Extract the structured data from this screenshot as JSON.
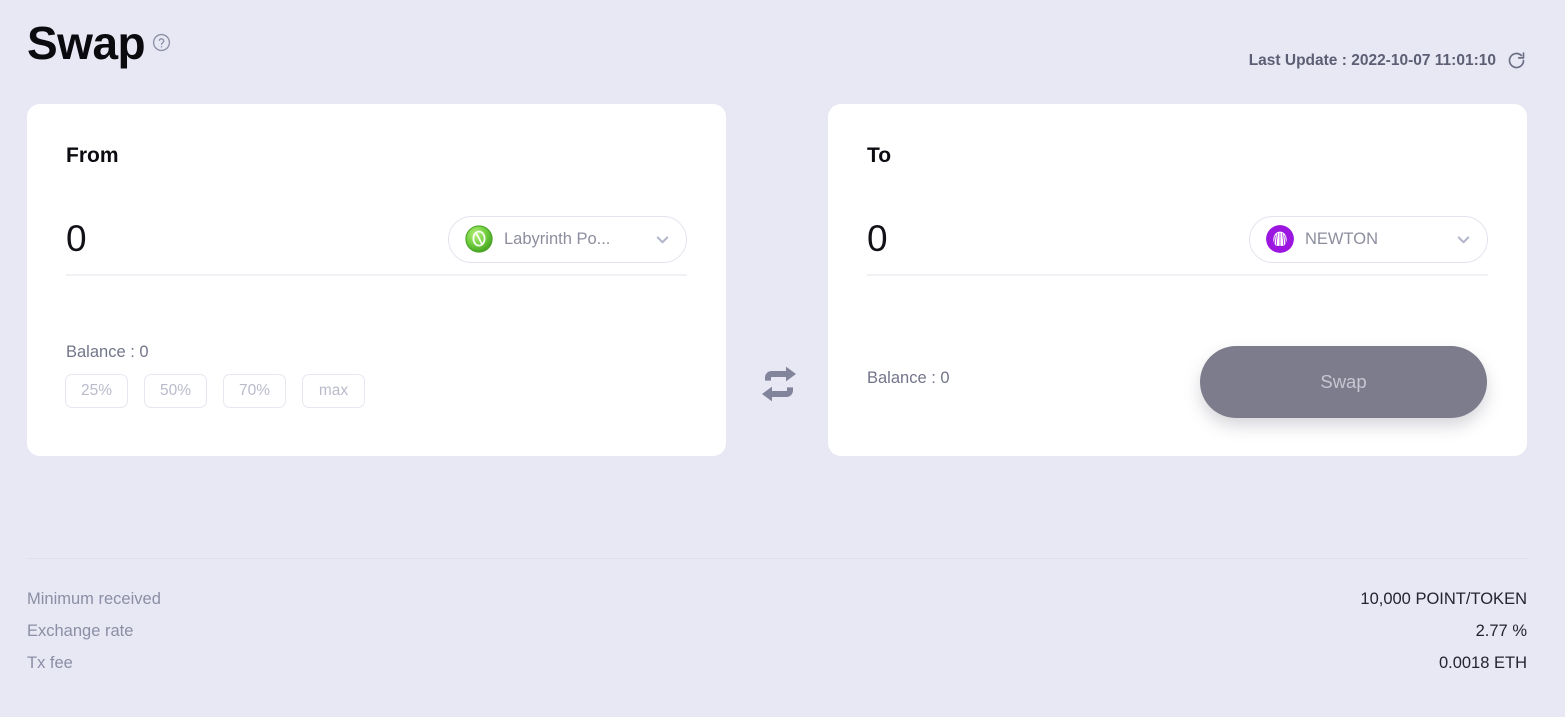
{
  "header": {
    "title": "Swap",
    "help_icon": "question-circle-icon",
    "last_update_label": "Last Update : 2022-10-07 11:01:10",
    "refresh_icon": "refresh-icon"
  },
  "from_card": {
    "label": "From",
    "amount": "0",
    "amount_placeholder": "0",
    "token": {
      "name": "Labyrinth Po...",
      "icon": "green-coin-icon",
      "icon_color": "#63c947",
      "chevron": "chevron-down-icon"
    },
    "balance_label": "Balance :  0",
    "percent_buttons": [
      "25%",
      "50%",
      "70%",
      "max"
    ]
  },
  "exchange_icon": "swap-arrows-icon",
  "to_card": {
    "label": "To",
    "amount": "0",
    "amount_placeholder": "0",
    "token": {
      "name": "NEWTON",
      "icon": "newton-shell-icon",
      "icon_color": "#9b17e0",
      "chevron": "chevron-down-icon"
    },
    "balance_label": "Balance :  0",
    "swap_button": "Swap"
  },
  "summary": {
    "rows": [
      {
        "label": "Minimum received",
        "value": "10,000 POINT/TOKEN"
      },
      {
        "label": "Exchange rate",
        "value": "2.77 %"
      },
      {
        "label": "Tx fee",
        "value": "0.0018 ETH"
      }
    ]
  },
  "colors": {
    "page_background": "#e8e8f5",
    "card_background": "#ffffff",
    "swap_button": "#7c7c8c",
    "accent_green": "#63c947",
    "accent_purple": "#9b17e0"
  }
}
